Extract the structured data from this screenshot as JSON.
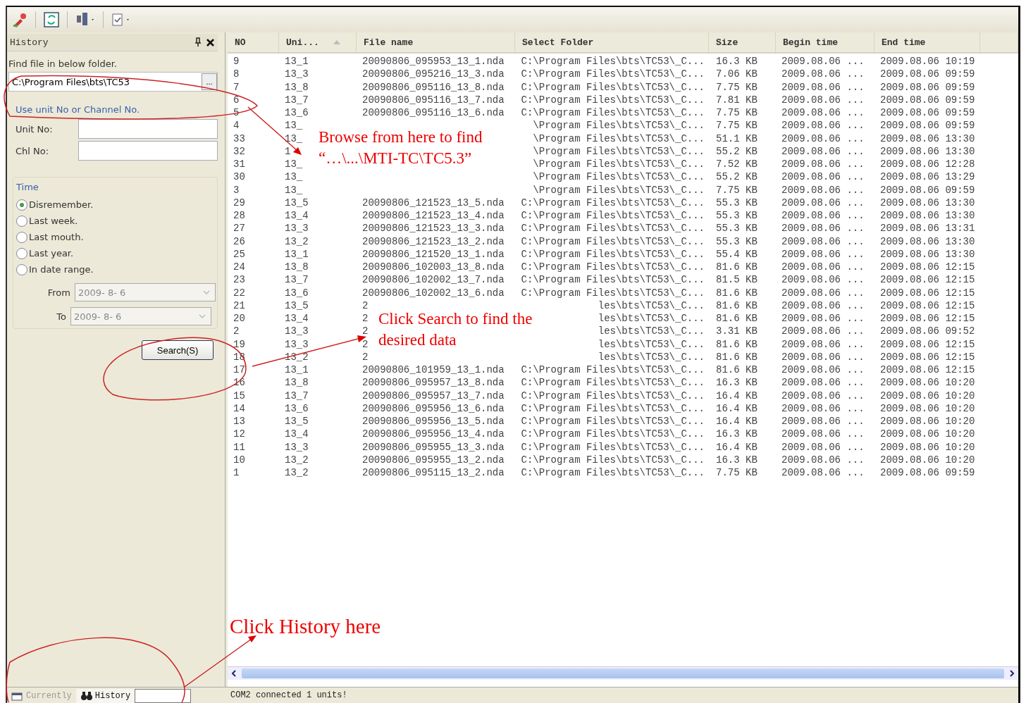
{
  "panel": {
    "title": "History",
    "folder_label": "Find file in below folder.",
    "folder_value": "C:\\Program Files\\bts\\TC53",
    "browse_button": "...",
    "unit_group": "Use unit No or Channel No.",
    "fields": [
      {
        "label": "Unit No:"
      },
      {
        "label": "Chl No:"
      }
    ],
    "time_group": "Time",
    "time_options": [
      {
        "label": "Disremember.",
        "selected": true
      },
      {
        "label": "Last week.",
        "selected": false
      },
      {
        "label": "Last mouth.",
        "selected": false
      },
      {
        "label": "Last year.",
        "selected": false
      },
      {
        "label": "In date range.",
        "selected": false
      }
    ],
    "dates": [
      {
        "label": "From",
        "value": "2009- 8- 6",
        "disabled": true
      },
      {
        "label": "To",
        "value": "2009- 8- 6",
        "disabled": true
      }
    ],
    "search_button": "Search(S)"
  },
  "table": {
    "columns": [
      {
        "label": "NO",
        "sorted": false
      },
      {
        "label": "Uni...",
        "sorted": true
      },
      {
        "label": "File name",
        "sorted": false
      },
      {
        "label": "Select Folder",
        "sorted": false
      },
      {
        "label": "Size",
        "sorted": false
      },
      {
        "label": "Begin time",
        "sorted": false
      },
      {
        "label": "End time",
        "sorted": false
      }
    ],
    "rows": [
      {
        "no": "9",
        "unit": "13_1",
        "file": "20090806_095953_13_1.nda",
        "folder": "C:\\Program Files\\bts\\TC53\\_C...",
        "size": "16.3 KB",
        "begin": "2009.08.06 ...",
        "end": "2009.08.06 10:19"
      },
      {
        "no": "8",
        "unit": "13_3",
        "file": "20090806_095216_13_3.nda",
        "folder": "C:\\Program Files\\bts\\TC53\\_C...",
        "size": "7.06 KB",
        "begin": "2009.08.06 ...",
        "end": "2009.08.06 09:59"
      },
      {
        "no": "7",
        "unit": "13_8",
        "file": "20090806_095116_13_8.nda",
        "folder": "C:\\Program Files\\bts\\TC53\\_C...",
        "size": "7.75 KB",
        "begin": "2009.08.06 ...",
        "end": "2009.08.06 09:59"
      },
      {
        "no": "6",
        "unit": "13_7",
        "file": "20090806_095116_13_7.nda",
        "folder": "C:\\Program Files\\bts\\TC53\\_C...",
        "size": "7.81 KB",
        "begin": "2009.08.06 ...",
        "end": "2009.08.06 09:59"
      },
      {
        "no": "5",
        "unit": "13_6",
        "file": "20090806_095116_13_6.nda",
        "folder": "C:\\Program Files\\bts\\TC53\\_C...",
        "size": "7.75 KB",
        "begin": "2009.08.06 ...",
        "end": "2009.08.06 09:59"
      },
      {
        "no": "4",
        "unit": "13_",
        "folder": "\\Program Files\\bts\\TC53\\_C...",
        "size": "7.75 KB",
        "begin": "2009.08.06 ...",
        "end": "2009.08.06 09:59"
      },
      {
        "no": "33",
        "unit": "13_",
        "folder": "\\Program Files\\bts\\TC53\\_C...",
        "size": "51.1 KB",
        "begin": "2009.08.06 ...",
        "end": "2009.08.06 13:30"
      },
      {
        "no": "32",
        "unit": "1",
        "folder": "\\Program Files\\bts\\TC53\\_C...",
        "size": "55.2 KB",
        "begin": "2009.08.06 ...",
        "end": "2009.08.06 13:30"
      },
      {
        "no": "31",
        "unit": "13_",
        "folder": "\\Program Files\\bts\\TC53\\_C...",
        "size": "7.52 KB",
        "begin": "2009.08.06 ...",
        "end": "2009.08.06 12:28"
      },
      {
        "no": "30",
        "unit": "13_",
        "folder": "\\Program Files\\bts\\TC53\\_C...",
        "size": "55.2 KB",
        "begin": "2009.08.06 ...",
        "end": "2009.08.06 13:29"
      },
      {
        "no": "3",
        "unit": "13_",
        "folder": "\\Program Files\\bts\\TC53\\_C...",
        "size": "7.75 KB",
        "begin": "2009.08.06 ...",
        "end": "2009.08.06 09:59"
      },
      {
        "no": "29",
        "unit": "13_5",
        "file": "20090806_121523_13_5.nda",
        "folder": "C:\\Program Files\\bts\\TC53\\_C...",
        "size": "55.3 KB",
        "begin": "2009.08.06 ...",
        "end": "2009.08.06 13:30"
      },
      {
        "no": "28",
        "unit": "13_4",
        "file": "20090806_121523_13_4.nda",
        "folder": "C:\\Program Files\\bts\\TC53\\_C...",
        "size": "55.3 KB",
        "begin": "2009.08.06 ...",
        "end": "2009.08.06 13:30"
      },
      {
        "no": "27",
        "unit": "13_3",
        "file": "20090806_121523_13_3.nda",
        "folder": "C:\\Program Files\\bts\\TC53\\_C...",
        "size": "55.3 KB",
        "begin": "2009.08.06 ...",
        "end": "2009.08.06 13:31"
      },
      {
        "no": "26",
        "unit": "13_2",
        "file": "20090806_121523_13_2.nda",
        "folder": "C:\\Program Files\\bts\\TC53\\_C...",
        "size": "55.3 KB",
        "begin": "2009.08.06 ...",
        "end": "2009.08.06 13:30"
      },
      {
        "no": "25",
        "unit": "13_1",
        "file": "20090806_121520_13_1.nda",
        "folder": "C:\\Program Files\\bts\\TC53\\_C...",
        "size": "55.4 KB",
        "begin": "2009.08.06 ...",
        "end": "2009.08.06 13:30"
      },
      {
        "no": "24",
        "unit": "13_8",
        "file": "20090806_102003_13_8.nda",
        "folder": "C:\\Program Files\\bts\\TC53\\_C...",
        "size": "81.6 KB",
        "begin": "2009.08.06 ...",
        "end": "2009.08.06 12:15"
      },
      {
        "no": "23",
        "unit": "13_7",
        "file": "20090806_102002_13_7.nda",
        "folder": "C:\\Program Files\\bts\\TC53\\_C...",
        "size": "81.5 KB",
        "begin": "2009.08.06 ...",
        "end": "2009.08.06 12:15"
      },
      {
        "no": "22",
        "unit": "13_6",
        "file": "20090806_102002_13_6.nda",
        "folder": "C:\\Program Files\\bts\\TC53\\_C...",
        "size": "81.6 KB",
        "begin": "2009.08.06 ...",
        "end": "2009.08.06 12:15"
      },
      {
        "no": "21",
        "unit": "13_5",
        "file": "2",
        "folder": "les\\bts\\TC53\\_C...",
        "size": "81.6 KB",
        "begin": "2009.08.06 ...",
        "end": "2009.08.06 12:15"
      },
      {
        "no": "20",
        "unit": "13_4",
        "file": "2",
        "folder": "les\\bts\\TC53\\_C...",
        "size": "81.6 KB",
        "begin": "2009.08.06 ...",
        "end": "2009.08.06 12:15"
      },
      {
        "no": "2",
        "unit": "13_3",
        "file": "2",
        "folder": "les\\bts\\TC53\\_C...",
        "size": "3.31 KB",
        "begin": "2009.08.06 ...",
        "end": "2009.08.06 09:52"
      },
      {
        "no": "19",
        "unit": "13_3",
        "file": "2",
        "folder": "les\\bts\\TC53\\_C...",
        "size": "81.6 KB",
        "begin": "2009.08.06 ...",
        "end": "2009.08.06 12:15"
      },
      {
        "no": "18",
        "unit": "13_2",
        "file": "2",
        "folder": "les\\bts\\TC53\\_C...",
        "size": "81.6 KB",
        "begin": "2009.08.06 ...",
        "end": "2009.08.06 12:15"
      },
      {
        "no": "17",
        "unit": "13_1",
        "file": "20090806_101959_13_1.nda",
        "folder": "C:\\Program Files\\bts\\TC53\\_C...",
        "size": "81.6 KB",
        "begin": "2009.08.06 ...",
        "end": "2009.08.06 12:15"
      },
      {
        "no": "16",
        "unit": "13_8",
        "file": "20090806_095957_13_8.nda",
        "folder": "C:\\Program Files\\bts\\TC53\\_C...",
        "size": "16.3 KB",
        "begin": "2009.08.06 ...",
        "end": "2009.08.06 10:20"
      },
      {
        "no": "15",
        "unit": "13_7",
        "file": "20090806_095957_13_7.nda",
        "folder": "C:\\Program Files\\bts\\TC53\\_C...",
        "size": "16.4 KB",
        "begin": "2009.08.06 ...",
        "end": "2009.08.06 10:20"
      },
      {
        "no": "14",
        "unit": "13_6",
        "file": "20090806_095956_13_6.nda",
        "folder": "C:\\Program Files\\bts\\TC53\\_C...",
        "size": "16.4 KB",
        "begin": "2009.08.06 ...",
        "end": "2009.08.06 10:20"
      },
      {
        "no": "13",
        "unit": "13_5",
        "file": "20090806_095956_13_5.nda",
        "folder": "C:\\Program Files\\bts\\TC53\\_C...",
        "size": "16.4 KB",
        "begin": "2009.08.06 ...",
        "end": "2009.08.06 10:20"
      },
      {
        "no": "12",
        "unit": "13_4",
        "file": "20090806_095956_13_4.nda",
        "folder": "C:\\Program Files\\bts\\TC53\\_C...",
        "size": "16.3 KB",
        "begin": "2009.08.06 ...",
        "end": "2009.08.06 10:20"
      },
      {
        "no": "11",
        "unit": "13_3",
        "file": "20090806_095955_13_3.nda",
        "folder": "C:\\Program Files\\bts\\TC53\\_C...",
        "size": "16.4 KB",
        "begin": "2009.08.06 ...",
        "end": "2009.08.06 10:20"
      },
      {
        "no": "10",
        "unit": "13_2",
        "file": "20090806_095955_13_2.nda",
        "folder": "C:\\Program Files\\bts\\TC53\\_C...",
        "size": "16.3 KB",
        "begin": "2009.08.06 ...",
        "end": "2009.08.06 10:20"
      },
      {
        "no": "1",
        "unit": "13_2",
        "file": "20090806_095115_13_2.nda",
        "folder": "C:\\Program Files\\bts\\TC53\\_C...",
        "size": "7.75 KB",
        "begin": "2009.08.06 ...",
        "end": "2009.08.06 09:59"
      }
    ]
  },
  "annotations": [
    {
      "kind": "callout",
      "lines": [
        "Browse from here to find",
        "“…\\...\\MTI-TC\\TC5.3”"
      ]
    },
    {
      "kind": "callout",
      "lines": [
        "Click Search to find the",
        "desired data"
      ]
    },
    {
      "kind": "note",
      "lines": [
        "Click History here"
      ]
    }
  ],
  "bottom_tabs": [
    {
      "label": "Currently",
      "selected": false
    },
    {
      "label": "History",
      "selected": true
    }
  ],
  "status": "COM2 connected 1 units!"
}
